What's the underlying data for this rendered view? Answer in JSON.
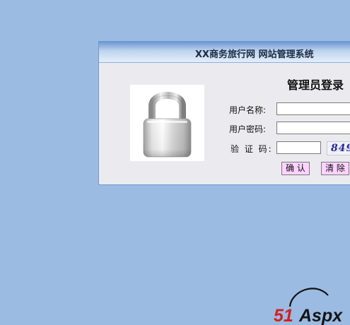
{
  "panel": {
    "title": "XX商务旅行网 网站管理系统",
    "heading": "管理员登录"
  },
  "form": {
    "username_label": "用户名称:",
    "password_label": "用户密码:",
    "captcha_label": "验 证 码:",
    "username_value": "",
    "password_value": "",
    "captcha_value": "",
    "captcha_text": "849"
  },
  "buttons": {
    "confirm_label": "确 认",
    "clear_label": "清 除"
  },
  "watermark": {
    "text_red": "51",
    "text_dark": "Aspx"
  },
  "icons": {
    "lock": "padlock-icon"
  },
  "colors": {
    "background": "#9bbbe2",
    "button_bg": "#ffd2ff",
    "captcha_text": "#2a2a9a",
    "watermark_red": "#d3201f"
  }
}
